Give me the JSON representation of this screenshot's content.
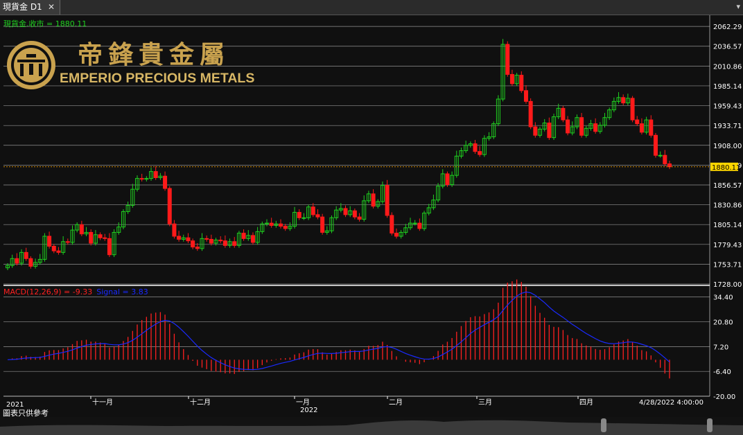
{
  "window": {
    "tab_title": "現貨金 D1",
    "close_glyph": "✕",
    "menu_glyph": "▾"
  },
  "header": {
    "price_label": "現貨金.收市 = 1880.11"
  },
  "logo": {
    "chinese": "帝鋒貴金屬",
    "english": "EMPERIO PRECIOUS METALS"
  },
  "colors": {
    "up": "#1fd01f",
    "down": "#ff1a1a",
    "macd": "#ff2020",
    "signal": "#1a2aff",
    "axis_text": "#ffffff",
    "price_tag_bg": "#ffd700",
    "last_line": "#d48a00"
  },
  "macd_label": {
    "macd": "MACD(12,26,9) = -9.33",
    "signal": "Signal = 3.83"
  },
  "footer": {
    "note": "圖表只供參考"
  },
  "chart_data": [
    {
      "type": "candlestick",
      "symbol": "現貨金",
      "timeframe": "D1",
      "last_close": 1880.11,
      "last_close_label": "1880.11",
      "y_ticks": [
        "2062.29",
        "2036.57",
        "2010.86",
        "1985.14",
        "1959.43",
        "1933.71",
        "1908.00",
        "1882.29",
        "1856.57",
        "1830.86",
        "1805.14",
        "1779.43",
        "1753.71",
        "1728.00"
      ],
      "ylim": [
        1728.0,
        2075.0
      ],
      "x_labels": [
        "2021",
        "十一月",
        "十二月",
        "一月",
        "2022",
        "二月",
        "三月",
        "四月",
        "4/28/2022 4:00:00"
      ],
      "x_tick_marks": [
        "十一月",
        "十二月",
        "一月",
        "二月",
        "三月",
        "四月"
      ],
      "close": [
        1752,
        1761,
        1755,
        1769,
        1761,
        1751,
        1756,
        1760,
        1790,
        1777,
        1771,
        1769,
        1783,
        1782,
        1798,
        1805,
        1793,
        1795,
        1781,
        1792,
        1788,
        1787,
        1766,
        1795,
        1802,
        1822,
        1830,
        1851,
        1865,
        1864,
        1865,
        1874,
        1866,
        1868,
        1852,
        1806,
        1790,
        1786,
        1788,
        1784,
        1776,
        1774,
        1787,
        1786,
        1781,
        1785,
        1784,
        1778,
        1783,
        1778,
        1794,
        1787,
        1791,
        1782,
        1796,
        1806,
        1807,
        1804,
        1806,
        1803,
        1800,
        1803,
        1821,
        1814,
        1814,
        1828,
        1818,
        1815,
        1795,
        1797,
        1814,
        1824,
        1826,
        1818,
        1823,
        1815,
        1812,
        1836,
        1845,
        1829,
        1835,
        1856,
        1817,
        1794,
        1790,
        1795,
        1801,
        1807,
        1807,
        1800,
        1820,
        1827,
        1837,
        1855,
        1871,
        1857,
        1869,
        1894,
        1901,
        1908,
        1910,
        1900,
        1896,
        1917,
        1919,
        1936,
        1968,
        2039,
        2000,
        1988,
        1999,
        1979,
        1965,
        1932,
        1921,
        1929,
        1937,
        1918,
        1945,
        1956,
        1941,
        1924,
        1932,
        1944,
        1921,
        1930,
        1936,
        1926,
        1934,
        1944,
        1954,
        1965,
        1970,
        1963,
        1969,
        1941,
        1936,
        1925,
        1941,
        1921,
        1895,
        1895,
        1884,
        1880.11
      ],
      "macd_ticks": [
        "34.40",
        "20.80",
        "7.20",
        "-6.40",
        "-20.00"
      ],
      "macd_ylim": [
        -20.0,
        40.0
      ],
      "macd_current": -9.33,
      "signal_current": 3.83
    }
  ]
}
